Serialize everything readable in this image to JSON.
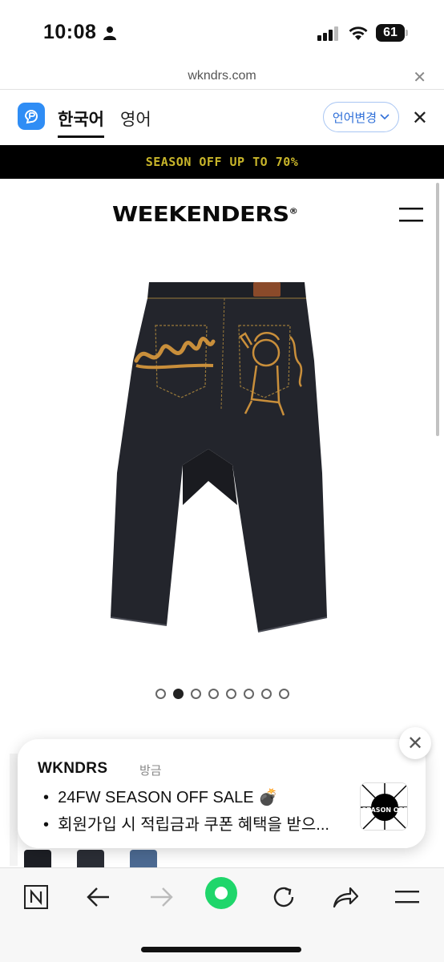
{
  "status_bar": {
    "time": "10:08",
    "battery": "61"
  },
  "url_bar": {
    "url": "wkndrs.com"
  },
  "translate_bar": {
    "tab_korean": "한국어",
    "tab_english": "영어",
    "change_language": "언어변경"
  },
  "promo_banner": {
    "text": "SEASON OFF UP TO 70%",
    "text_color": "#c8b52a"
  },
  "site_header": {
    "logo": "WEEKENDERS",
    "logo_mark": "®"
  },
  "carousel": {
    "total": 8,
    "active_index": 1
  },
  "notification": {
    "source": "WKNDRS",
    "time": "방금",
    "line1": "24FW SEASON OFF SALE 💣",
    "line2": "회원가입 시 적립금과 쿠폰 혜택을 받으...",
    "thumb_text": "SEASON OFF"
  },
  "toolbar": {
    "accent": "#1fd66b"
  }
}
